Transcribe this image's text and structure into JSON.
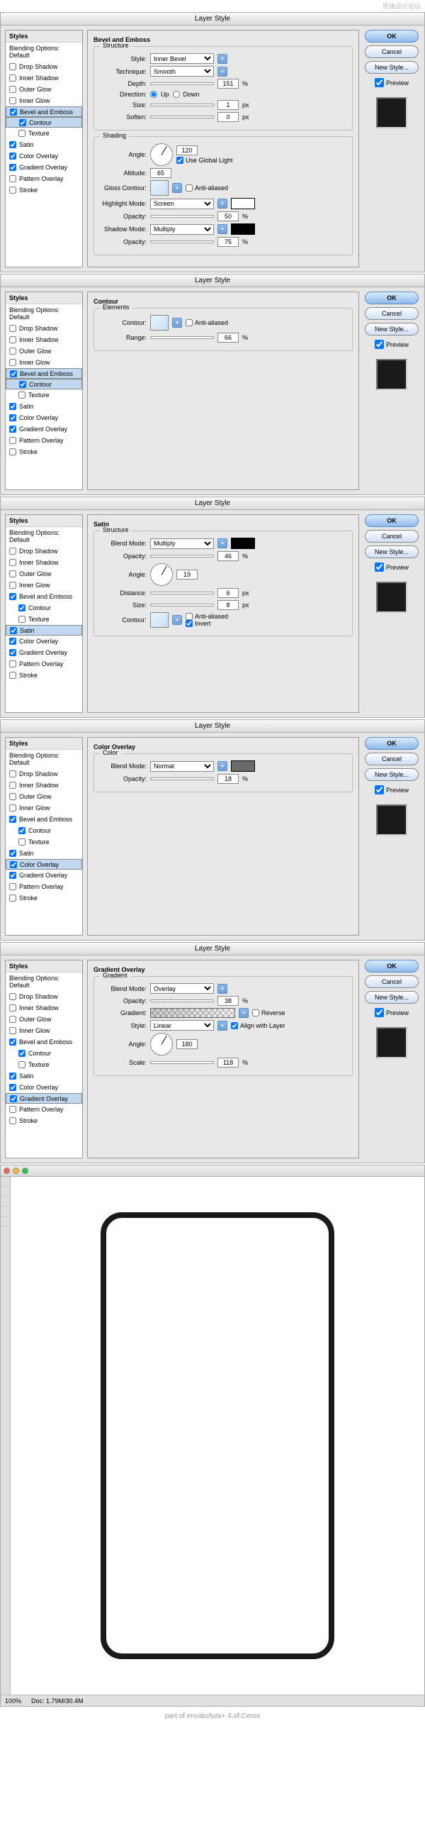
{
  "top_watermark": "思维设计论坛",
  "dialog_title": "Layer Style",
  "sidebar": {
    "head": "Styles",
    "blending": "Blending Options: Default",
    "items": {
      "drop_shadow": "Drop Shadow",
      "inner_shadow": "Inner Shadow",
      "outer_glow": "Outer Glow",
      "inner_glow": "Inner Glow",
      "bevel_emboss": "Bevel and Emboss",
      "contour": "Contour",
      "texture": "Texture",
      "satin": "Satin",
      "color_overlay": "Color Overlay",
      "gradient_overlay": "Gradient Overlay",
      "pattern_overlay": "Pattern Overlay",
      "stroke": "Stroke"
    }
  },
  "buttons": {
    "ok": "OK",
    "cancel": "Cancel",
    "new_style": "New Style...",
    "preview": "Preview"
  },
  "bevel": {
    "title": "Bevel and Emboss",
    "structure": "Structure",
    "style_lbl": "Style:",
    "style_val": "Inner Bevel",
    "technique_lbl": "Technique:",
    "technique_val": "Smooth",
    "depth_lbl": "Depth:",
    "depth_val": "151",
    "depth_unit": "%",
    "direction_lbl": "Direction:",
    "up": "Up",
    "down": "Down",
    "size_lbl": "Size:",
    "size_val": "1",
    "px": "px",
    "soften_lbl": "Soften:",
    "soften_val": "0",
    "shading": "Shading",
    "angle_lbl": "Angle:",
    "angle_val": "120",
    "global_light": "Use Global Light",
    "altitude_lbl": "Altitude:",
    "altitude_val": "65",
    "gloss_lbl": "Gloss Contour:",
    "anti_aliased": "Anti-aliased",
    "highlight_mode_lbl": "Highlight Mode:",
    "highlight_mode_val": "Screen",
    "opacity_lbl": "Opacity:",
    "h_opacity": "50",
    "shadow_mode_lbl": "Shadow Mode:",
    "shadow_mode_val": "Multiply",
    "s_opacity": "75",
    "pct": "%"
  },
  "contour": {
    "title": "Contour",
    "elements": "Elements",
    "contour_lbl": "Contour:",
    "anti_aliased": "Anti-aliased",
    "range_lbl": "Range:",
    "range_val": "66",
    "pct": "%"
  },
  "satin": {
    "title": "Satin",
    "structure": "Structure",
    "blend_mode_lbl": "Blend Mode:",
    "blend_mode_val": "Multiply",
    "opacity_lbl": "Opacity:",
    "opacity_val": "46",
    "pct": "%",
    "angle_lbl": "Angle:",
    "angle_val": "19",
    "distance_lbl": "Distance:",
    "distance_val": "6",
    "px": "px",
    "size_lbl": "Size:",
    "size_val": "8",
    "contour_lbl": "Contour:",
    "anti_aliased": "Anti-aliased",
    "invert": "Invert"
  },
  "color_overlay": {
    "title": "Color Overlay",
    "color": "Color",
    "blend_mode_lbl": "Blend Mode:",
    "blend_mode_val": "Normal",
    "opacity_lbl": "Opacity:",
    "opacity_val": "18",
    "pct": "%"
  },
  "gradient_overlay": {
    "title": "Gradient Overlay",
    "gradient": "Gradient",
    "blend_mode_lbl": "Blend Mode:",
    "blend_mode_val": "Overlay",
    "opacity_lbl": "Opacity:",
    "opacity_val": "38",
    "pct": "%",
    "gradient_lbl": "Gradient:",
    "reverse": "Reverse",
    "style_lbl": "Style:",
    "style_val": "Linear",
    "align": "Align with Layer",
    "angle_lbl": "Angle:",
    "angle_val": "180",
    "scale_lbl": "Scale:",
    "scale_val": "118"
  },
  "canvas": {
    "zoom": "100%",
    "doc": "Doc: 1.79M/30.4M"
  },
  "footer": "part of envato/tuts+ 4.of.Ceros"
}
